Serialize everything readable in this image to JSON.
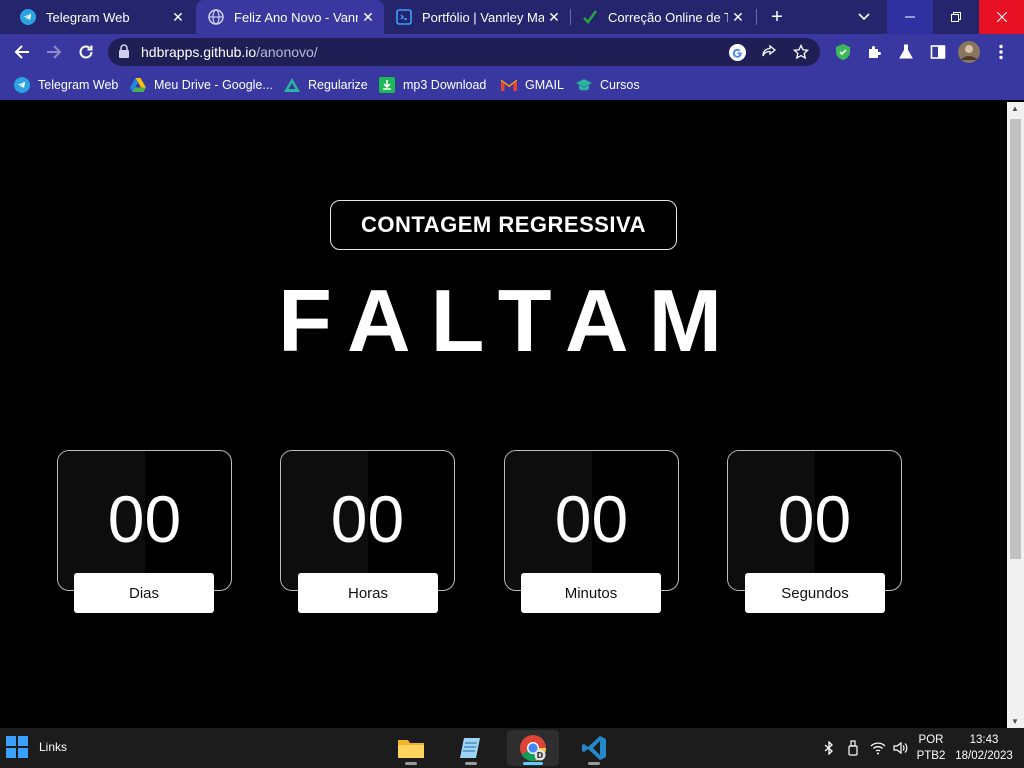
{
  "browser": {
    "tabs": [
      {
        "title": "Telegram Web",
        "icon": "telegram-icon",
        "active": false
      },
      {
        "title": "Feliz Ano Novo - Vanrley",
        "icon": "globe-icon",
        "active": true
      },
      {
        "title": "Portfólio | Vanrley Macedo",
        "icon": "vscode-icon",
        "active": false
      },
      {
        "title": "Correção Online de Texto",
        "icon": "checkmark-icon",
        "active": false
      }
    ],
    "url_domain": "hdbrapps.github.io",
    "url_path": "/anonovo/",
    "bookmarks": [
      {
        "label": "Telegram Web",
        "icon": "telegram-icon"
      },
      {
        "label": "Meu Drive - Google...",
        "icon": "google-drive-icon"
      },
      {
        "label": "Regularize",
        "icon": "regularize-icon"
      },
      {
        "label": "mp3 Download",
        "icon": "download-icon"
      },
      {
        "label": "GMAIL",
        "icon": "gmail-icon"
      },
      {
        "label": "Cursos",
        "icon": "graduation-cap-icon"
      }
    ]
  },
  "page": {
    "badge": "CONTAGEM REGRESSIVA",
    "headline": "FALTAM",
    "timers": [
      {
        "value": "00",
        "label": "Dias"
      },
      {
        "value": "00",
        "label": "Horas"
      },
      {
        "value": "00",
        "label": "Minutos"
      },
      {
        "value": "00",
        "label": "Segundos"
      }
    ]
  },
  "taskbar": {
    "links_label": "Links",
    "apps": [
      "file-explorer-icon",
      "notepad-icon",
      "chrome-icon",
      "vscode-icon"
    ],
    "language": "POR",
    "keyboard": "PTB2",
    "time": "13:43",
    "date": "18/02/2023"
  },
  "colors": {
    "tabbar": "#25256e",
    "toolbar": "#3838a0",
    "page_bg": "#000000",
    "close_red": "#e81123"
  }
}
